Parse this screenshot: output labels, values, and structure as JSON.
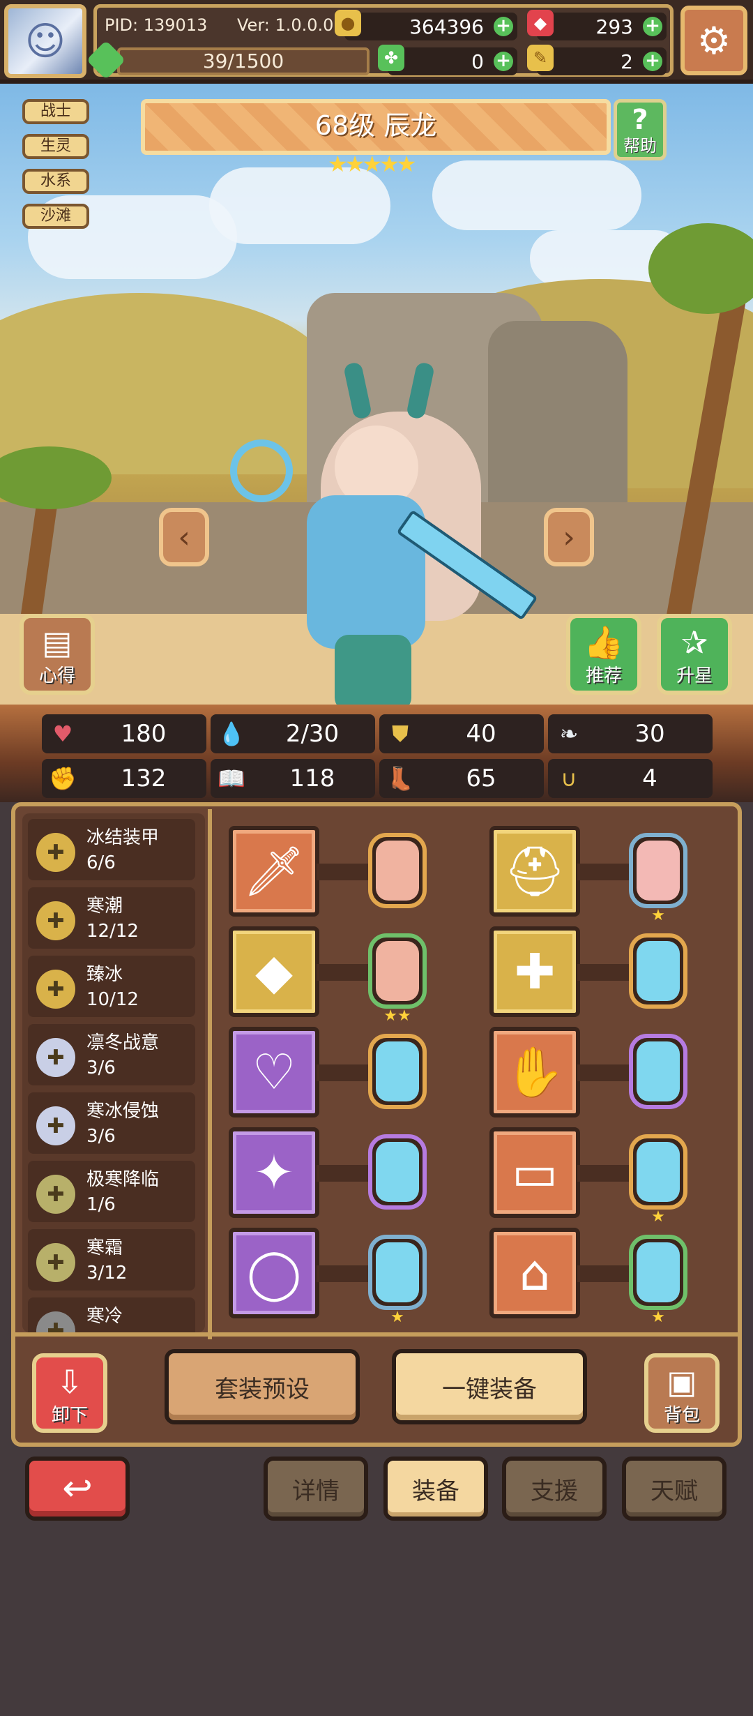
{
  "header": {
    "pid_label": "PID: 139013",
    "version_label": "Ver: 1.0.0.0",
    "gold": "364396",
    "gems": "293",
    "exp": "39/1500",
    "clover": "0",
    "ticket": "2"
  },
  "hero": {
    "tags": [
      "战士",
      "生灵",
      "水系",
      "沙滩"
    ],
    "name": "68级 辰龙",
    "stars": "★★★★★",
    "help_label": "帮助",
    "insight_label": "心得",
    "recommend_label": "推荐",
    "star_up_label": "升星"
  },
  "stats": [
    {
      "icon": "heart-icon",
      "value": "180",
      "color": "#e25b6a"
    },
    {
      "icon": "water-drop-icon",
      "value": "2/30",
      "color": "#5fc1e8"
    },
    {
      "icon": "shield-icon",
      "value": "40",
      "color": "#e8c04b"
    },
    {
      "icon": "wing-icon",
      "value": "30",
      "color": "#e8eef2"
    },
    {
      "icon": "fist-icon",
      "value": "132",
      "color": "#e27a6a"
    },
    {
      "icon": "book-icon",
      "value": "118",
      "color": "#6fb7e4"
    },
    {
      "icon": "boot-icon",
      "value": "65",
      "color": "#e8c04b"
    },
    {
      "icon": "horseshoe-icon",
      "value": "4",
      "color": "#e8c04b"
    }
  ],
  "sets": [
    {
      "name": "冰结装甲",
      "count": "6/6",
      "coin_color": "#d9b24a"
    },
    {
      "name": "寒潮",
      "count": "12/12",
      "coin_color": "#d9b24a"
    },
    {
      "name": "臻冰",
      "count": "10/12",
      "coin_color": "#d9b24a"
    },
    {
      "name": "凛冬战意",
      "count": "3/6",
      "coin_color": "#c9cfe6"
    },
    {
      "name": "寒冰侵蚀",
      "count": "3/6",
      "coin_color": "#c9cfe6"
    },
    {
      "name": "极寒降临",
      "count": "1/6",
      "coin_color": "#b8b06a"
    },
    {
      "name": "寒霜",
      "count": "3/12",
      "coin_color": "#b8b06a"
    },
    {
      "name": "寒冷",
      "count": "",
      "coin_color": "#8a8a8a"
    }
  ],
  "equipment": [
    {
      "slot": "sword-icon",
      "gem_stars": ""
    },
    {
      "slot": "helmet-icon",
      "gem_stars": "★"
    },
    {
      "slot": "diamond-shield-icon",
      "gem_stars": "★★"
    },
    {
      "slot": "armor-icon",
      "gem_stars": ""
    },
    {
      "slot": "necklace-icon",
      "gem_stars": ""
    },
    {
      "slot": "gauntlet-icon",
      "gem_stars": ""
    },
    {
      "slot": "gem-amulet-icon",
      "gem_stars": ""
    },
    {
      "slot": "belt-icon",
      "gem_stars": "★"
    },
    {
      "slot": "ring-icon",
      "gem_stars": "★"
    },
    {
      "slot": "boots-icon",
      "gem_stars": "★"
    }
  ],
  "actions": {
    "unequip_label": "卸下",
    "preset_label": "套装预设",
    "auto_equip_label": "一键装备",
    "bag_label": "背包"
  },
  "nav": {
    "tabs": [
      "详情",
      "装备",
      "支援",
      "天赋"
    ],
    "active": "装备"
  }
}
